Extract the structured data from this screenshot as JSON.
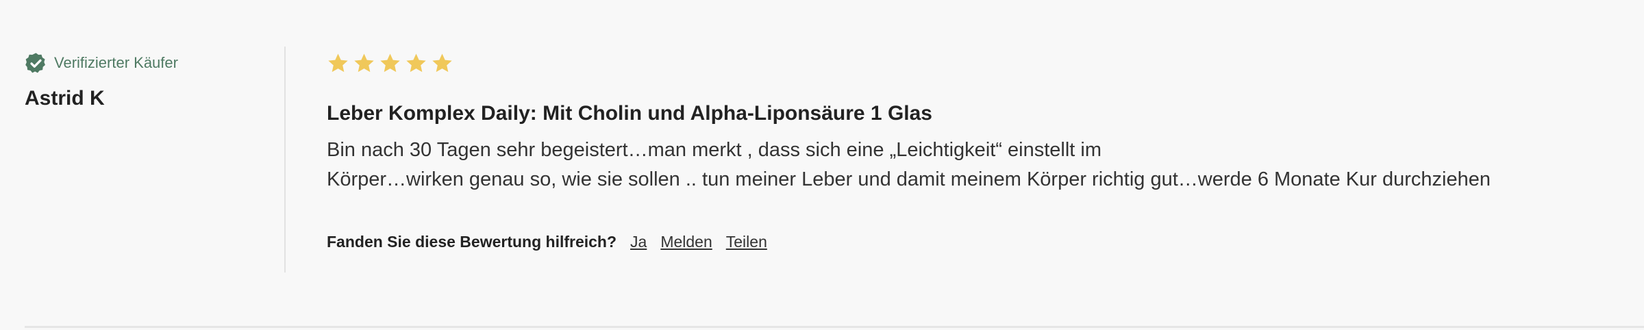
{
  "review": {
    "verified_label": "Verifizierter Käufer",
    "author": "Astrid K",
    "rating": 5,
    "rating_max": 5,
    "star_color": "#f0c85a",
    "verified_color": "#4f7a63",
    "title": "Leber Komplex Daily: Mit Cholin und Alpha-Liponsäure 1 Glas",
    "body_lines": [
      "Bin nach 30 Tagen sehr begeistert…man merkt , dass sich eine „Leichtigkeit“ einstellt im",
      "Körper…wirken genau so, wie sie sollen .. tun meiner Leber und damit meinem Körper richtig gut…werde 6 Monate Kur durchziehen"
    ],
    "helpful": {
      "question": "Fanden Sie diese Bewertung hilfreich?",
      "yes_label": "Ja",
      "report_label": "Melden",
      "share_label": "Teilen"
    },
    "icons": {
      "verified": "check-badge-icon",
      "star": "star-icon"
    }
  }
}
